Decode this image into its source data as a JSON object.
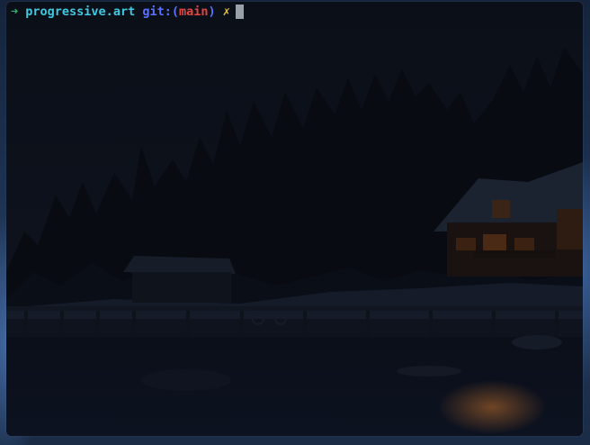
{
  "terminal": {
    "prompt": {
      "arrow": "➜",
      "directory": "progressive.art",
      "git_prefix": "git:(",
      "branch": "main",
      "git_suffix": ")",
      "dirty_marker": "✗"
    }
  },
  "colors": {
    "background": "#0c1019",
    "arrow": "#2bb673",
    "directory": "#40c9e0",
    "git": "#5a72ff",
    "branch": "#e2463f",
    "dirty": "#e8c33a",
    "cursor": "#9aa0a8"
  },
  "background_image": "snowy-lakeside-cabin-night"
}
